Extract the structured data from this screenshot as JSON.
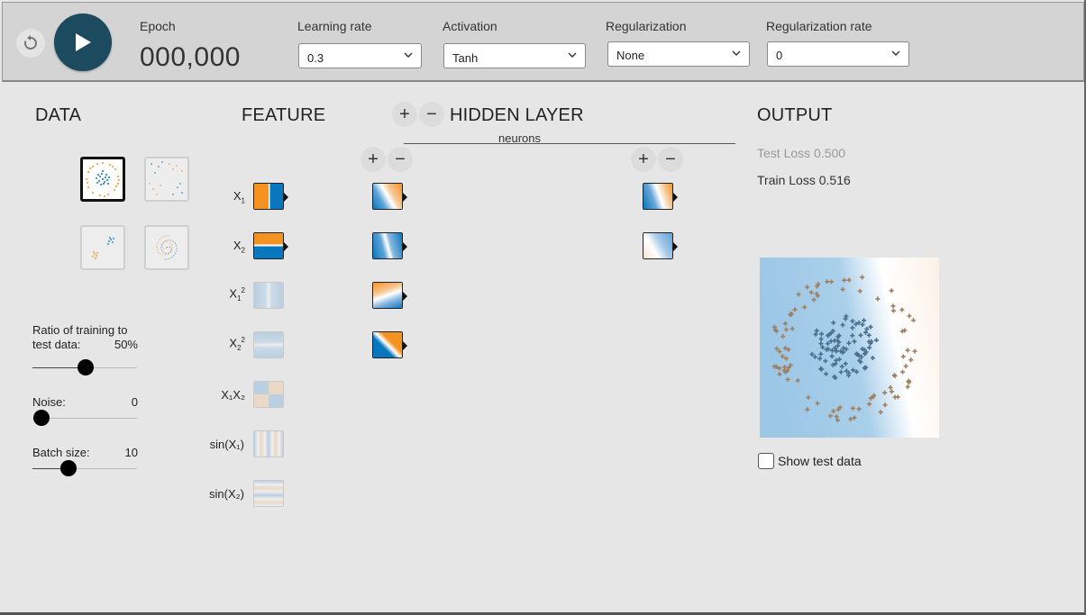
{
  "controls": {
    "epoch_label": "Epoch",
    "epoch_value": "000,000",
    "learning_rate": {
      "label": "Learning rate",
      "value": "0.3"
    },
    "activation": {
      "label": "Activation",
      "value": "Tanh"
    },
    "regularization": {
      "label": "Regularization",
      "value": "None"
    },
    "regularization_rate": {
      "label": "Regularization rate",
      "value": "0"
    }
  },
  "data_panel": {
    "title": "DATA",
    "datasets": [
      {
        "name": "circle",
        "selected": true
      },
      {
        "name": "xor",
        "selected": false
      },
      {
        "name": "gaussian",
        "selected": false
      },
      {
        "name": "spiral",
        "selected": false
      }
    ],
    "ratio": {
      "label_line1": "Ratio of training to",
      "label_line2": "test data:",
      "value": "50%",
      "level": 0.5
    },
    "noise": {
      "label": "Noise:",
      "value": "0",
      "level": 0
    },
    "batch": {
      "label": "Batch size:",
      "value": "10",
      "level": 0.3
    }
  },
  "features": {
    "title": "FEATURE",
    "items": [
      {
        "label": "X",
        "sub": "1",
        "active": true,
        "icon": "x1-feature-icon"
      },
      {
        "label": "X",
        "sub": "2",
        "active": true,
        "icon": "x2-feature-icon"
      },
      {
        "label": "X",
        "sub": "1",
        "sup": "2",
        "active": false,
        "icon": "x1-squared-feature-icon"
      },
      {
        "label": "X",
        "sub": "2",
        "sup": "2",
        "active": false,
        "icon": "x2-squared-feature-icon"
      },
      {
        "label": "X₁X₂",
        "active": false,
        "icon": "x1x2-feature-icon"
      },
      {
        "label": "sin(X₁)",
        "active": false,
        "icon": "sin-x1-feature-icon"
      },
      {
        "label": "sin(X₂)",
        "active": false,
        "icon": "sin-x2-feature-icon"
      }
    ]
  },
  "hidden": {
    "title": "HIDDEN LAYER",
    "neurons_label": "neurons",
    "plus": "+",
    "minus": "−",
    "layers": [
      {
        "neuron_count": 4
      },
      {
        "neuron_count": 2
      }
    ]
  },
  "output": {
    "title": "OUTPUT",
    "test_loss": "Test Loss 0.500",
    "train_loss": "Train Loss 0.516",
    "show_test_label": "Show test data",
    "show_test_checked": false
  },
  "colors": {
    "orange": "#f59322",
    "blue": "#0877bd",
    "play_bg": "#1c4a5e",
    "point_blue": "#4a6f8f",
    "point_orange": "#a08060"
  }
}
